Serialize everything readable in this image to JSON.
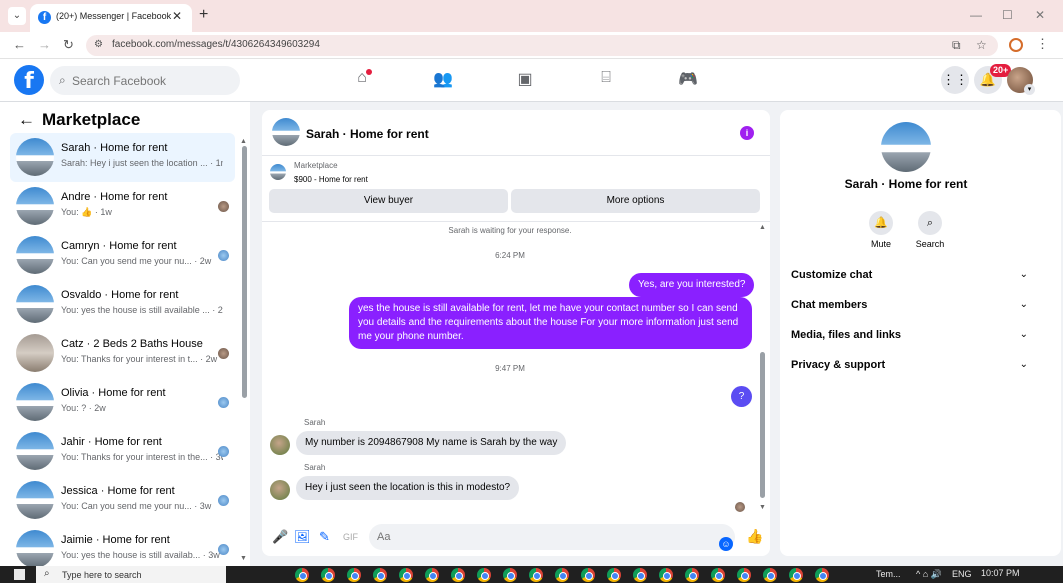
{
  "browser": {
    "tab_title": "(20+) Messenger | Facebook",
    "url": "facebook.com/messages/t/4306264349603294"
  },
  "fb": {
    "search_placeholder": "Search Facebook",
    "notif_badge": "20+"
  },
  "left": {
    "title": "Marketplace",
    "conversations": [
      {
        "name": "Sarah · Home for rent",
        "snippet": "Sarah: Hey i just seen the location ... · 1m",
        "active": true
      },
      {
        "name": "Andre · Home for rent",
        "snippet": "You: 👍 · 1w"
      },
      {
        "name": "Camryn · Home for rent",
        "snippet": "You: Can you send me your nu... · 2w"
      },
      {
        "name": "Osvaldo · Home for rent",
        "snippet": "You: yes the house is still available ... · 2w"
      },
      {
        "name": "Catz · 2 Beds 2 Baths House",
        "snippet": "You: Thanks for your interest in t... · 2w"
      },
      {
        "name": "Olivia · Home for rent",
        "snippet": "You: ? · 2w"
      },
      {
        "name": "Jahir · Home for rent",
        "snippet": "You: Thanks for your interest in the... · 3w"
      },
      {
        "name": "Jessica · Home for rent",
        "snippet": "You: Can you send me your nu... · 3w"
      },
      {
        "name": "Jaimie · Home for rent",
        "snippet": "You: yes the house is still availab... · 3w"
      }
    ]
  },
  "chat": {
    "title": "Sarah · Home for rent",
    "listing_label": "Marketplace",
    "listing_price": "$900 - Home for rent",
    "view_buyer": "View buyer",
    "more_options": "More options",
    "waiting_note": "Sarah is waiting for your response.",
    "time1": "6:24 PM",
    "msg_out1": "Yes, are you interested?",
    "msg_out2": "yes the house is still available for rent, let me have your contact number so I can send you details and the requirements about the house For your more information just send me your phone number.",
    "time2": "9:47 PM",
    "msg_out3": "?",
    "sender": "Sarah",
    "msg_in1": "My number is 2094867908 My name is Sarah by the way",
    "msg_in2": "Hey i just seen the location is this in modesto?",
    "composer_placeholder": "Aa"
  },
  "right": {
    "name": "Sarah · Home for rent",
    "mute": "Mute",
    "search": "Search",
    "sections": [
      "Customize chat",
      "Chat members",
      "Media, files and links",
      "Privacy & support"
    ]
  },
  "taskbar": {
    "search_placeholder": "Type here to search",
    "weather": "Tem...",
    "lang": "ENG",
    "time": "10:07 PM"
  },
  "colors": {
    "accent": "#8a20ff",
    "fb_blue": "#1877f2"
  }
}
